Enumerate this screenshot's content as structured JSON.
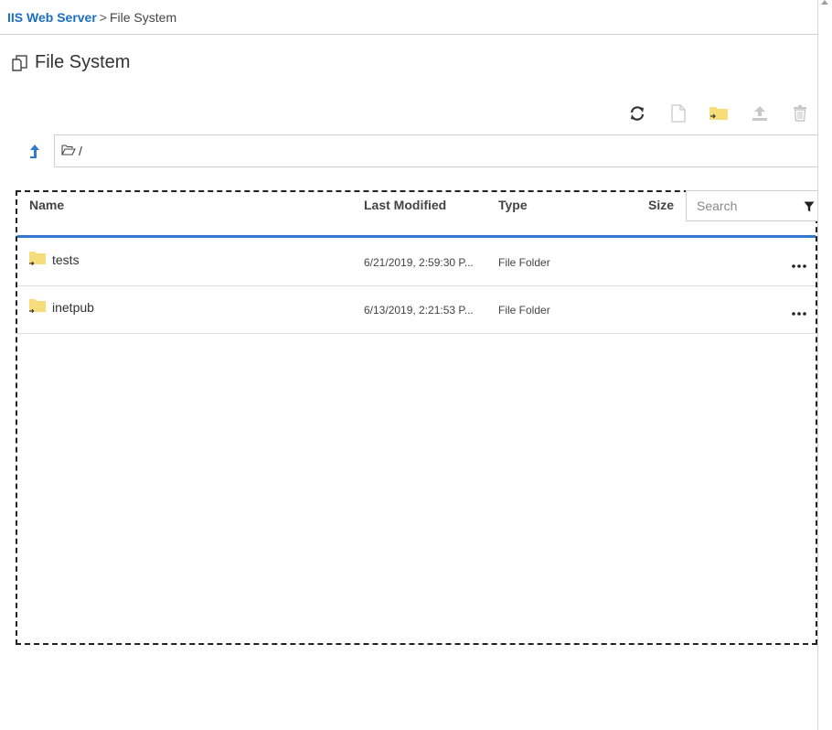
{
  "breadcrumb": {
    "root": "IIS Web Server",
    "separator": ">",
    "current": "File System"
  },
  "header": {
    "title": "File System",
    "icon": "file-system-icon"
  },
  "toolbar": {
    "buttons": [
      {
        "name": "refresh",
        "icon": "refresh-icon",
        "enabled": true
      },
      {
        "name": "new-file",
        "icon": "new-file-icon",
        "enabled": false
      },
      {
        "name": "new-folder",
        "icon": "new-folder-icon",
        "enabled": true
      },
      {
        "name": "upload",
        "icon": "upload-icon",
        "enabled": false
      },
      {
        "name": "delete",
        "icon": "trash-icon",
        "enabled": false
      }
    ]
  },
  "path": {
    "value": "/"
  },
  "list": {
    "columns": {
      "name": "Name",
      "last_modified": "Last Modified",
      "type": "Type",
      "size": "Size"
    },
    "search": {
      "placeholder": "Search",
      "value": ""
    },
    "rows": [
      {
        "name": "tests",
        "last_modified": "6/21/2019, 2:59:30 P...",
        "type": "File Folder",
        "size": ""
      },
      {
        "name": "inetpub",
        "last_modified": "6/13/2019, 2:21:53 P...",
        "type": "File Folder",
        "size": ""
      }
    ]
  },
  "colors": {
    "accent": "#2f7ad0",
    "link": "#1a6fc4",
    "folder": "#f6dc7a",
    "disabled_icon": "#c8c8c8"
  }
}
